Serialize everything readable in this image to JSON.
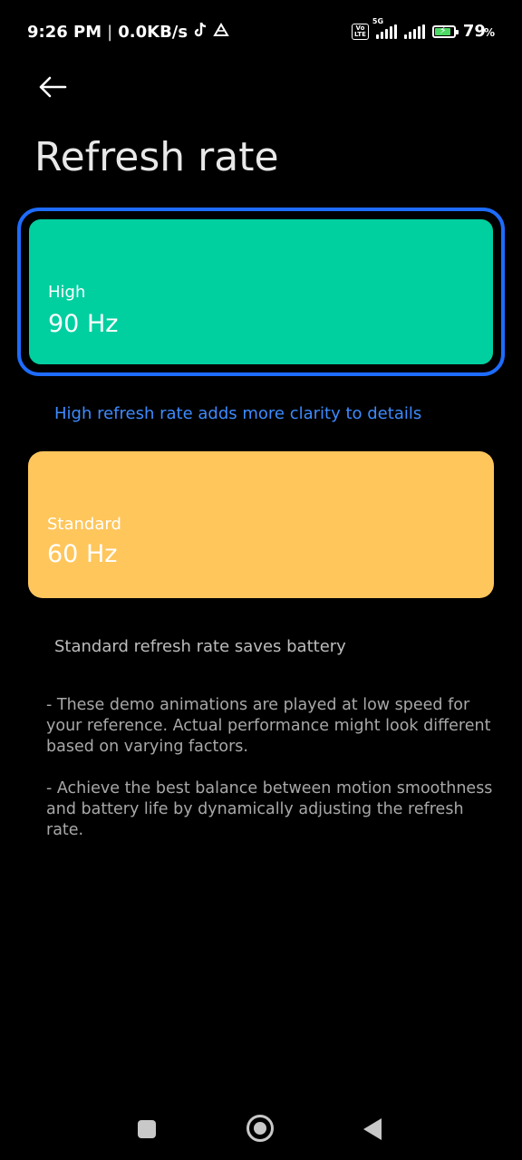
{
  "status_bar": {
    "time": "9:26 PM",
    "separator": "|",
    "net_speed": "0.0KB/s",
    "volte_line1": "Vo",
    "volte_line2": "LTE",
    "network_tag": "5G",
    "battery_percent": "79",
    "percent_symbol": "%",
    "battery_level": 0.79,
    "icons": [
      "tiktok-icon",
      "drive-icon",
      "volte-icon",
      "signal-icon",
      "signal-icon",
      "battery-charging-icon"
    ]
  },
  "header": {
    "back_icon": "arrow-left-icon",
    "title": "Refresh rate"
  },
  "options": {
    "high": {
      "label": "High",
      "value": "90 Hz",
      "caption": "High refresh rate adds more clarity to details",
      "color": "#00cfa0",
      "selected": true
    },
    "standard": {
      "label": "Standard",
      "value": "60 Hz",
      "caption": "Standard refresh rate saves battery",
      "color": "#ffc65c",
      "selected": false
    }
  },
  "notes": {
    "note1": "- These demo animations are played at low speed for your reference. Actual performance might look different based on varying factors.",
    "note2": "- Achieve the best balance between motion smoothness and battery life by dynamically adjusting the refresh rate."
  },
  "colors": {
    "accent": "#1e6cff",
    "caption_accent": "#3d8bff",
    "background": "#000000"
  },
  "nav_bar": {
    "icons": [
      "recents-square-icon",
      "home-circle-icon",
      "back-triangle-icon"
    ]
  }
}
